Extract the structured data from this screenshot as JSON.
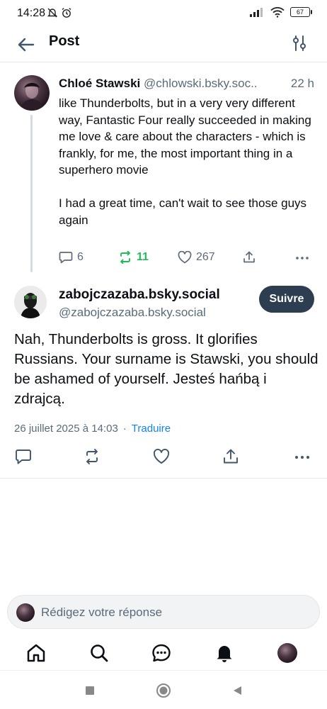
{
  "status_bar": {
    "time": "14:28",
    "battery": "67"
  },
  "header": {
    "title": "Post",
    "back_icon": "arrow-left-icon",
    "filter_icon": "sliders-icon"
  },
  "parent_post": {
    "author_name": "Chloé Stawski",
    "author_handle": "@chlowski.bsky.soc..",
    "time": "22 h",
    "text_lines_1": "like Thunderbolts, but in a very very different way, Fantastic Four really succeeded in making me love & care about the characters - which is frankly, for me, the most important thing in a superhero movie",
    "text_lines_2": "I had a great time, can't wait to see those guys again",
    "replies": "6",
    "reposts": "11",
    "likes": "267"
  },
  "main_post": {
    "author_name": "zabojczazaba.bsky.social",
    "author_handle": "@zabojczazaba.bsky.social",
    "follow_label": "Suivre",
    "text": "Nah, Thunderbolts is gross. It glorifies Russians. Your surname is Stawski, you should be ashamed of yourself. Jesteś hańbą i zdrajcą.",
    "date": "26 juillet 2025 à 14:03",
    "separator": "·",
    "translate_label": "Traduire"
  },
  "reply": {
    "placeholder": "Rédigez votre réponse"
  },
  "colors": {
    "accent": "#1083fe",
    "repost_active": "#20bc5a",
    "follow_bg": "#2c3e50",
    "muted": "#5b6b7a"
  }
}
